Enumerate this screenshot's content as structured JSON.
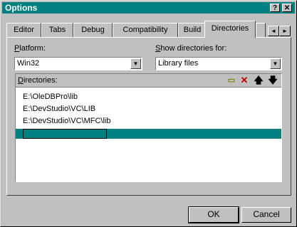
{
  "window": {
    "title": "Options",
    "help_label": "?",
    "close_label": "✕"
  },
  "tabs": [
    {
      "label": "Editor"
    },
    {
      "label": "Tabs"
    },
    {
      "label": "Debug"
    },
    {
      "label": "Compatibility"
    },
    {
      "label": "Build"
    },
    {
      "label": "Directories",
      "active": true
    }
  ],
  "tab_scroll": {
    "left": "◄",
    "right": "►"
  },
  "platform": {
    "label_u": "P",
    "label_rest": "latform:",
    "value": "Win32"
  },
  "show_dirs": {
    "label_u": "S",
    "label_rest": "how directories for:",
    "value": "Library files"
  },
  "directories": {
    "label_u": "D",
    "label_rest": "irectories:",
    "items": [
      "E:\\OleDBPro\\lib",
      "E:\\DevStudio\\VC\\LIB",
      "E:\\DevStudio\\VC\\MFC\\lib"
    ],
    "editing_value": ""
  },
  "buttons": {
    "ok": "OK",
    "cancel": "Cancel"
  }
}
